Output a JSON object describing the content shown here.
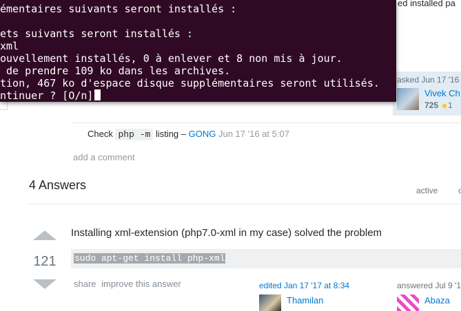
{
  "terminal": {
    "lines": [
      "émentaires suivants seront installés :",
      "",
      "ets suivants seront installés :",
      "xml",
      "ouvellement installés, 0 à enlever et 8 non mis à jour.",
      " de prendre 109 ko dans les archives.",
      "tion, 467 ko d'espace disque supplémentaires seront utilisés.",
      "ntinuer ? [O/n]"
    ]
  },
  "question": {
    "right_top_text": "ed installed pa",
    "asked_label": "asked Jun 17 '16",
    "asker_name": "Vivek Ch",
    "asker_rep": "725",
    "asker_badges": "1"
  },
  "comment": {
    "prefix": "Check",
    "code": "php -m",
    "suffix": "listing –",
    "user": "GONG",
    "date": "Jun 17 '16 at 5:07"
  },
  "add_comment": "add a comment",
  "answers": {
    "heading": "4 Answers",
    "sort_active": "active",
    "sort_oldest": "o"
  },
  "answer": {
    "votes": "121",
    "text": "Installing xml-extension (php7.0-xml in my case) solved the problem",
    "code": "sudo apt-get install php-xml",
    "menu_share": "share",
    "menu_improve": "improve this answer",
    "edited_label": "edited Jan 17 '17 at 8:34",
    "editor_name": "Thamilan",
    "answered_label": "answered Jul 9 '1",
    "answerer_name": "Abaza"
  }
}
